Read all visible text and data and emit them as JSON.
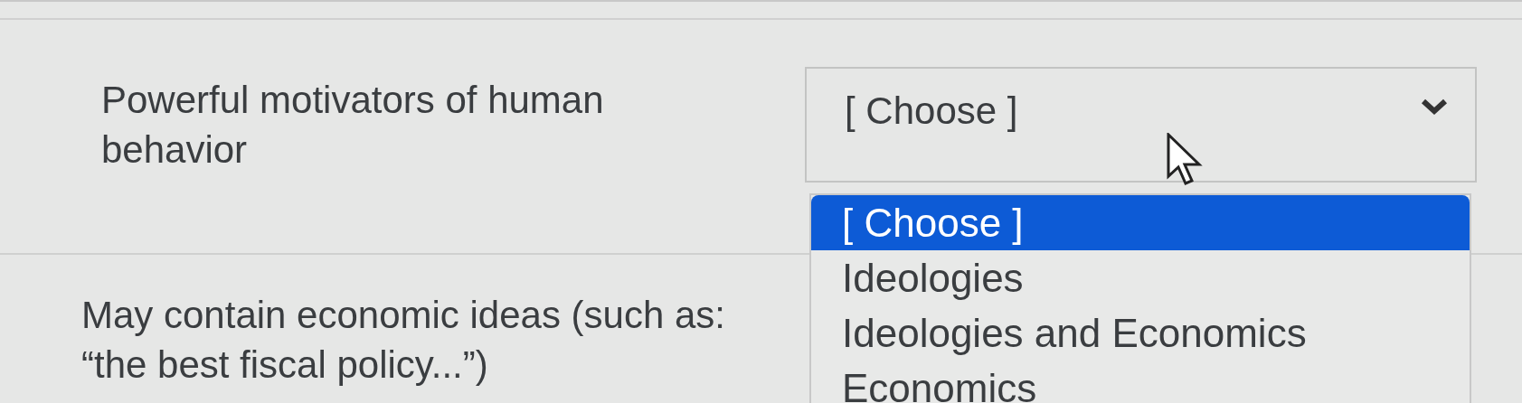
{
  "questions": [
    {
      "prompt": "Powerful motivators of human behavior",
      "select": {
        "value": "[ Choose ]",
        "open": true,
        "options": [
          {
            "label": "[ Choose ]",
            "selected": true
          },
          {
            "label": "Ideologies",
            "selected": false
          },
          {
            "label": "Ideologies and Economics",
            "selected": false
          },
          {
            "label": "Economics",
            "selected": false
          }
        ]
      }
    },
    {
      "prompt": "May contain economic ideas (such as: “the best fiscal policy...”)"
    }
  ]
}
